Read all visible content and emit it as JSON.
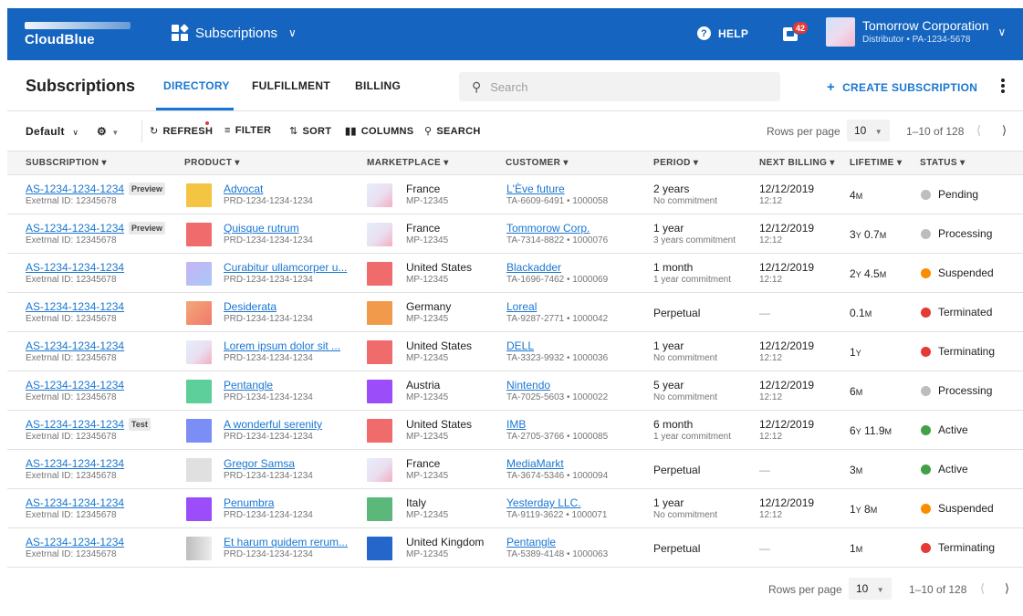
{
  "topbar": {
    "logo": "CloudBlue",
    "module": "Subscriptions",
    "help": "HELP",
    "notifications": "42",
    "account_name": "Tomorrow Corporation",
    "account_sub": "Distributor • PA-1234-5678",
    "color": "#1565c0"
  },
  "page": {
    "title": "Subscriptions",
    "tabs": [
      "DIRECTORY",
      "FULFILLMENT",
      "BILLING"
    ],
    "active_tab": "DIRECTORY",
    "search_placeholder": "Search",
    "create_button": "CREATE SUBSCRIPTION"
  },
  "toolbar": {
    "view": "Default",
    "refresh": "REFRESH",
    "filter": "FILTER",
    "sort": "SORT",
    "columns": "COLUMNS",
    "search": "SEARCH",
    "rows_per_page_label": "Rows per page",
    "rows_per_page": "10",
    "range": "1–10 of 128"
  },
  "columns": [
    "SUBSCRIPTION",
    "PRODUCT",
    "MARKETPLACE",
    "CUSTOMER",
    "PERIOD",
    "NEXT BILLING",
    "LIFETIME",
    "STATUS"
  ],
  "rows": [
    {
      "id": "AS-1234-1234-1234",
      "ext": "Exetrnal ID: 12345678",
      "badge": "Preview",
      "product": "Advocat",
      "product_id": "PRD-1234-1234-1234",
      "product_color": "#f4c542",
      "market": "France",
      "market_id": "MP-12345",
      "market_color": "gradient",
      "customer": "L'Ève future",
      "customer_id": "TA-6609-6491 • 1000058",
      "period": "2 years",
      "period_sub": "No commitment",
      "billing": "12/12/2019",
      "billing_time": "12:12",
      "life_a": "4",
      "life_au": "M",
      "life_b": "",
      "life_bu": "",
      "status": "Pending",
      "status_color": "#bdbdbd"
    },
    {
      "id": "AS-1234-1234-1234",
      "ext": "Exetrnal ID: 12345678",
      "badge": "Preview",
      "product": "Quisque rutrum",
      "product_id": "PRD-1234-1234-1234",
      "product_color": "#f06b6b",
      "market": "France",
      "market_id": "MP-12345",
      "market_color": "gradient",
      "customer": "Tommorow Corp.",
      "customer_id": "TA-7314-8822 • 1000076",
      "period": "1 year",
      "period_sub": "3 years commitment",
      "billing": "12/12/2019",
      "billing_time": "12:12",
      "life_a": "3",
      "life_au": "Y",
      "life_b": "0.7",
      "life_bu": "M",
      "status": "Processing",
      "status_color": "#bdbdbd"
    },
    {
      "id": "AS-1234-1234-1234",
      "ext": "Exetrnal ID: 12345678",
      "badge": "",
      "product": "Curabitur ullamcorper u...",
      "product_id": "PRD-1234-1234-1234",
      "product_color": "gradient2",
      "market": "United States",
      "market_id": "MP-12345",
      "market_color": "#f06b6b",
      "customer": "Blackadder",
      "customer_id": "TA-1696-7462 • 1000069",
      "period": "1 month",
      "period_sub": "1 year commitment",
      "billing": "12/12/2019",
      "billing_time": "12:12",
      "life_a": "2",
      "life_au": "Y",
      "life_b": "4.5",
      "life_bu": "M",
      "status": "Suspended",
      "status_color": "#fb8c00"
    },
    {
      "id": "AS-1234-1234-1234",
      "ext": "Exetrnal ID: 12345678",
      "badge": "",
      "product": "Desiderata",
      "product_id": "PRD-1234-1234-1234",
      "product_color": "gradient3",
      "market": "Germany",
      "market_id": "MP-12345",
      "market_color": "#f29a4b",
      "customer": "Loreal",
      "customer_id": "TA-9287-2771 • 1000042",
      "period": "Perpetual",
      "period_sub": "",
      "billing": "—",
      "billing_time": "",
      "life_a": "0.1",
      "life_au": "M",
      "life_b": "",
      "life_bu": "",
      "status": "Terminated",
      "status_color": "#e53935"
    },
    {
      "id": "AS-1234-1234-1234",
      "ext": "Exetrnal ID: 12345678",
      "badge": "",
      "product": "Lorem ipsum dolor sit ...",
      "product_id": "PRD-1234-1234-1234",
      "product_color": "gradient",
      "market": "United States",
      "market_id": "MP-12345",
      "market_color": "#f06b6b",
      "customer": "DELL",
      "customer_id": "TA-3323-9932 • 1000036",
      "period": "1 year",
      "period_sub": "No commitment",
      "billing": "12/12/2019",
      "billing_time": "12:12",
      "life_a": "1",
      "life_au": "Y",
      "life_b": "",
      "life_bu": "",
      "status": "Terminating",
      "status_color": "#e53935"
    },
    {
      "id": "AS-1234-1234-1234",
      "ext": "Exetrnal ID: 12345678",
      "badge": "",
      "product": "Pentangle",
      "product_id": "PRD-1234-1234-1234",
      "product_color": "#5ccf9a",
      "market": "Austria",
      "market_id": "MP-12345",
      "market_color": "#9b4dfa",
      "customer": "Nintendo",
      "customer_id": "TA-7025-5603 • 1000022",
      "period": "5 year",
      "period_sub": "No commitment",
      "billing": "12/12/2019",
      "billing_time": "12:12",
      "life_a": "6",
      "life_au": "M",
      "life_b": "",
      "life_bu": "",
      "status": "Processing",
      "status_color": "#bdbdbd"
    },
    {
      "id": "AS-1234-1234-1234",
      "ext": "Exetrnal ID: 12345678",
      "badge": "Test",
      "product": "A wonderful serenity",
      "product_id": "PRD-1234-1234-1234",
      "product_color": "#7b8ef5",
      "market": "United States",
      "market_id": "MP-12345",
      "market_color": "#f06b6b",
      "customer": "IMB",
      "customer_id": "TA-2705-3766 • 1000085",
      "period": "6 month",
      "period_sub": "1 year commitment",
      "billing": "12/12/2019",
      "billing_time": "12:12",
      "life_a": "6",
      "life_au": "Y",
      "life_b": "11.9",
      "life_bu": "M",
      "status": "Active",
      "status_color": "#43a047"
    },
    {
      "id": "AS-1234-1234-1234",
      "ext": "Exetrnal ID: 12345678",
      "badge": "",
      "product": "Gregor Samsa",
      "product_id": "PRD-1234-1234-1234",
      "product_color": "#e0e0e0",
      "market": "France",
      "market_id": "MP-12345",
      "market_color": "gradient",
      "customer": "MediaMarkt",
      "customer_id": "TA-3674-5346 • 1000094",
      "period": "Perpetual",
      "period_sub": "",
      "billing": "—",
      "billing_time": "",
      "life_a": "3",
      "life_au": "M",
      "life_b": "",
      "life_bu": "",
      "status": "Active",
      "status_color": "#43a047"
    },
    {
      "id": "AS-1234-1234-1234",
      "ext": "Exetrnal ID: 12345678",
      "badge": "",
      "product": "Penumbra",
      "product_id": "PRD-1234-1234-1234",
      "product_color": "#9b4dfa",
      "market": "Italy",
      "market_id": "MP-12345",
      "market_color": "#5cb87a",
      "customer": "Yesterday LLC.",
      "customer_id": "TA-9119-3622 • 1000071",
      "period": "1 year",
      "period_sub": "No commitment",
      "billing": "12/12/2019",
      "billing_time": "12:12",
      "life_a": "1",
      "life_au": "Y",
      "life_b": "8",
      "life_bu": "M",
      "status": "Suspended",
      "status_color": "#fb8c00"
    },
    {
      "id": "AS-1234-1234-1234",
      "ext": "Exetrnal ID: 12345678",
      "badge": "",
      "product": "Et harum quidem rerum...",
      "product_id": "PRD-1234-1234-1234",
      "product_color": "gradient4",
      "market": "United Kingdom",
      "market_id": "MP-12345",
      "market_color": "#2466c9",
      "customer": "Pentangle",
      "customer_id": "TA-5389-4148 • 1000063",
      "period": "Perpetual",
      "period_sub": "",
      "billing": "—",
      "billing_time": "",
      "life_a": "1",
      "life_au": "M",
      "life_b": "",
      "life_bu": "",
      "status": "Terminating",
      "status_color": "#e53935"
    }
  ],
  "footer": {
    "rows_per_page_label": "Rows per page",
    "rows_per_page": "10",
    "range": "1–10 of 128"
  }
}
